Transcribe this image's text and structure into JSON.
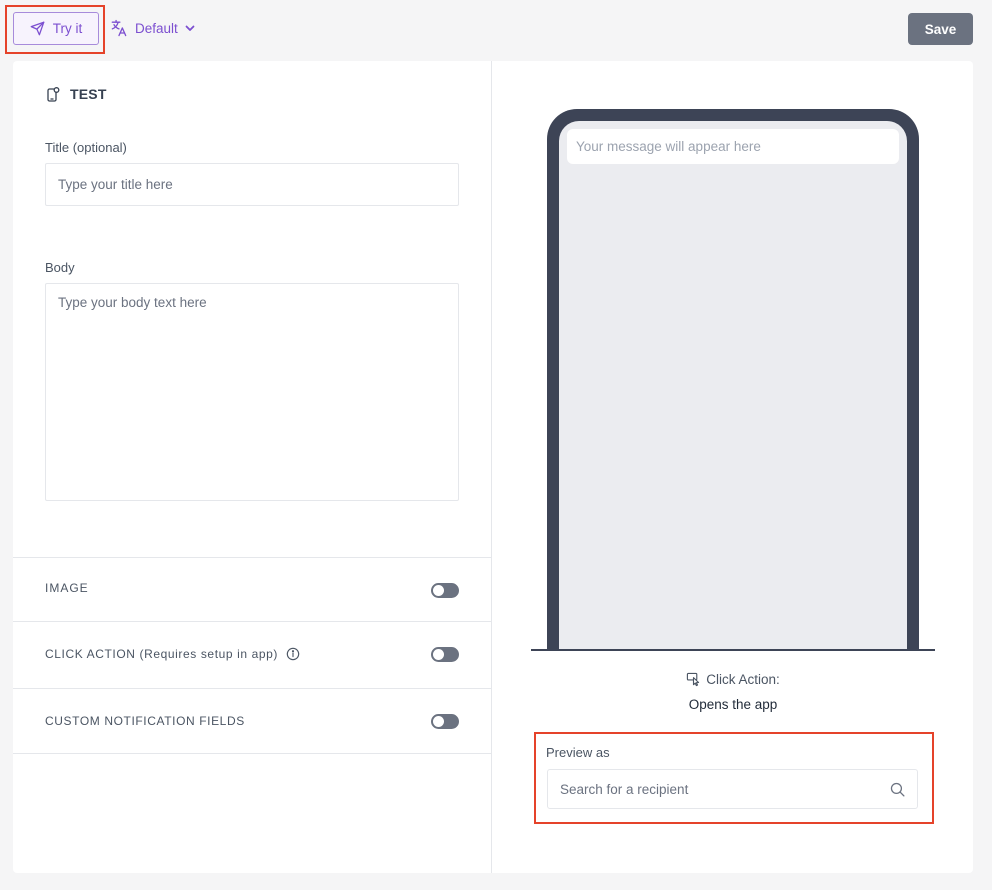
{
  "toolbar": {
    "try_label": "Try it",
    "language_label": "Default",
    "save_label": "Save"
  },
  "editor": {
    "section_title": "TEST",
    "title_label": "Title (optional)",
    "title_placeholder": "Type your title here",
    "body_label": "Body",
    "body_placeholder": "Type your body text here",
    "toggles": [
      {
        "label": "IMAGE",
        "enabled": false
      },
      {
        "label": "CLICK ACTION (Requires setup in app)",
        "enabled": false
      },
      {
        "label": "CUSTOM NOTIFICATION FIELDS",
        "enabled": false
      }
    ]
  },
  "preview": {
    "message_placeholder": "Your message will appear here",
    "click_action_label": "Click Action:",
    "click_action_value": "Opens the app",
    "preview_as_label": "Preview as",
    "search_placeholder": "Search for a recipient"
  },
  "colors": {
    "accent": "#7c4fd0",
    "highlight": "#e5432a",
    "phone": "#3d4456",
    "save": "#6b7280"
  }
}
